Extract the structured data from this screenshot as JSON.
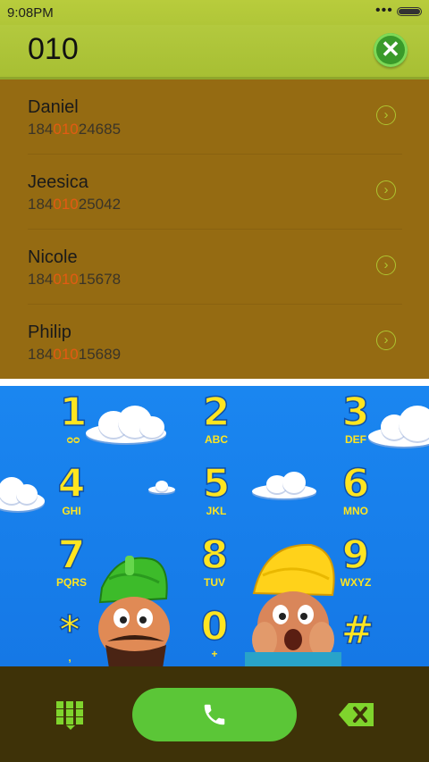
{
  "status_bar": {
    "time": "9:08PM",
    "dots": "•••"
  },
  "dial_input": {
    "value": "010"
  },
  "contacts": [
    {
      "name": "Daniel",
      "phone_prefix": "184",
      "phone_match": "010",
      "phone_suffix": "24685"
    },
    {
      "name": "Jeesica",
      "phone_prefix": "184",
      "phone_match": "010",
      "phone_suffix": "25042"
    },
    {
      "name": "Nicole",
      "phone_prefix": "184",
      "phone_match": "010",
      "phone_suffix": "15678"
    },
    {
      "name": "Philip",
      "phone_prefix": "184",
      "phone_match": "010",
      "phone_suffix": "15689"
    }
  ],
  "keypad": {
    "keys": [
      {
        "digit": "1",
        "letters": ""
      },
      {
        "digit": "2",
        "letters": "ABC"
      },
      {
        "digit": "3",
        "letters": "DEF"
      },
      {
        "digit": "4",
        "letters": "GHI"
      },
      {
        "digit": "5",
        "letters": "JKL"
      },
      {
        "digit": "6",
        "letters": "MNO"
      },
      {
        "digit": "7",
        "letters": "PQRS"
      },
      {
        "digit": "8",
        "letters": "TUV"
      },
      {
        "digit": "9",
        "letters": "WXYZ"
      },
      {
        "digit": "*",
        "letters": ","
      },
      {
        "digit": "0",
        "letters": "+"
      },
      {
        "digit": "#",
        "letters": ""
      }
    ],
    "voicemail_icon": "voicemail-icon"
  },
  "colors": {
    "header": "#b0c638",
    "list_background": "#956b12",
    "match_highlight": "#e35b12",
    "keypad_background": "#1a86f0",
    "key_digit": "#ffe520",
    "bottom_bar": "#3e3208",
    "call_button": "#5bc637"
  }
}
